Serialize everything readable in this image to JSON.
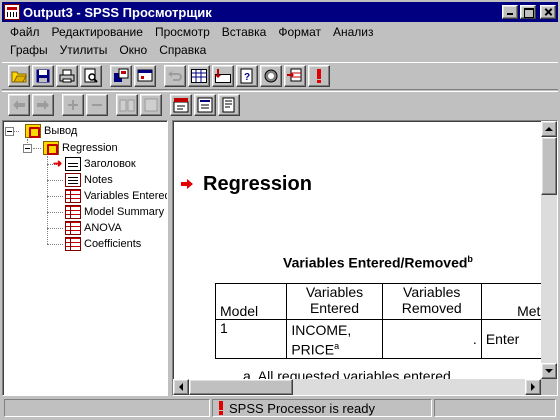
{
  "window": {
    "title": "Output3 - SPSS Просмотрщик"
  },
  "menu": {
    "row1": [
      "Файл",
      "Редактирование",
      "Просмотр",
      "Вставка",
      "Формат",
      "Анализ"
    ],
    "row2": [
      "Графы",
      "Утилиты",
      "Окно",
      "Справка"
    ]
  },
  "toolbar": {
    "row1_icons": [
      "open-icon",
      "save-icon",
      "print-icon",
      "print-preview-icon",
      "export-icon",
      "dialog-recall-icon",
      "undo-icon",
      "data-view-icon",
      "goto-case-icon",
      "variables-icon",
      "use-sets-icon",
      "insert-cases-icon",
      "designate-window-icon"
    ],
    "row2_icons": [
      "promote-icon",
      "demote-icon",
      "expand-icon",
      "collapse-icon",
      "show-icon",
      "hide-icon",
      "insert-heading-icon",
      "insert-title-icon",
      "insert-text-icon"
    ]
  },
  "outline": {
    "root": "Вывод",
    "group": "Regression",
    "items": [
      "Заголовок",
      "Notes",
      "Variables Entered",
      "Model Summary",
      "ANOVA",
      "Coefficients"
    ]
  },
  "content": {
    "heading": "Regression",
    "table_title": "Variables Entered/Removed",
    "table_title_sup": "b",
    "table": {
      "headers": [
        "Model",
        "Variables Entered",
        "Variables Removed",
        "Metho"
      ],
      "row": {
        "model": "1",
        "entered_line1": "INCOME,",
        "entered_line2": "PRICE",
        "entered_sup": "a",
        "removed": ".",
        "method": "Enter"
      }
    },
    "footnote": "a. All requested variables entered."
  },
  "status": {
    "text": "SPSS Processor  is ready"
  },
  "colors": {
    "titlebar": "#000080",
    "accent_red": "#e00000",
    "face": "#c0c0c0"
  }
}
